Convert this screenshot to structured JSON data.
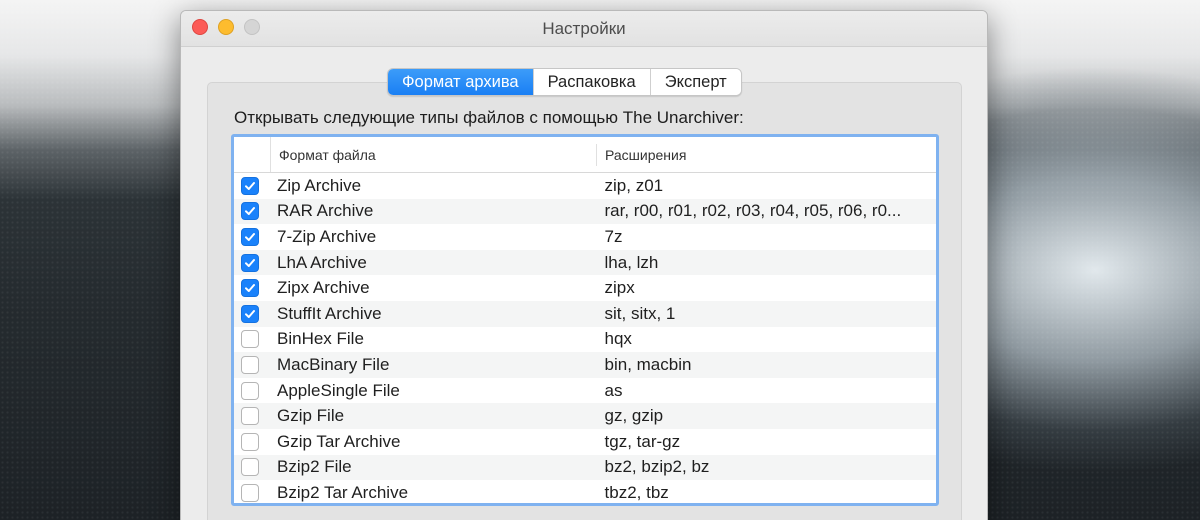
{
  "window": {
    "title": "Настройки"
  },
  "tabs": [
    {
      "label": "Формат архива",
      "active": true
    },
    {
      "label": "Распаковка",
      "active": false
    },
    {
      "label": "Эксперт",
      "active": false
    }
  ],
  "caption": "Открывать следующие типы файлов с помощью The Unarchiver:",
  "table": {
    "headers": {
      "format": "Формат файла",
      "extensions": "Расширения"
    },
    "rows": [
      {
        "checked": true,
        "format": "Zip Archive",
        "extensions": "zip, z01"
      },
      {
        "checked": true,
        "format": "RAR Archive",
        "extensions": "rar, r00, r01, r02, r03, r04, r05, r06, r0..."
      },
      {
        "checked": true,
        "format": "7-Zip Archive",
        "extensions": "7z"
      },
      {
        "checked": true,
        "format": "LhA Archive",
        "extensions": "lha, lzh"
      },
      {
        "checked": true,
        "format": "Zipx Archive",
        "extensions": "zipx"
      },
      {
        "checked": true,
        "format": "StuffIt Archive",
        "extensions": "sit, sitx, 1"
      },
      {
        "checked": false,
        "format": "BinHex File",
        "extensions": "hqx"
      },
      {
        "checked": false,
        "format": "MacBinary File",
        "extensions": "bin, macbin"
      },
      {
        "checked": false,
        "format": "AppleSingle File",
        "extensions": "as"
      },
      {
        "checked": false,
        "format": "Gzip File",
        "extensions": "gz, gzip"
      },
      {
        "checked": false,
        "format": "Gzip Tar Archive",
        "extensions": "tgz, tar-gz"
      },
      {
        "checked": false,
        "format": "Bzip2 File",
        "extensions": "bz2, bzip2, bz"
      },
      {
        "checked": false,
        "format": "Bzip2 Tar Archive",
        "extensions": "tbz2, tbz"
      }
    ]
  },
  "colors": {
    "accent": "#1a82fb",
    "close": "#fc5b57",
    "minimize": "#fdbc2e",
    "zoom_inactive": "#d5d5d5"
  },
  "icons": {
    "checkmark": "checkmark-icon"
  }
}
